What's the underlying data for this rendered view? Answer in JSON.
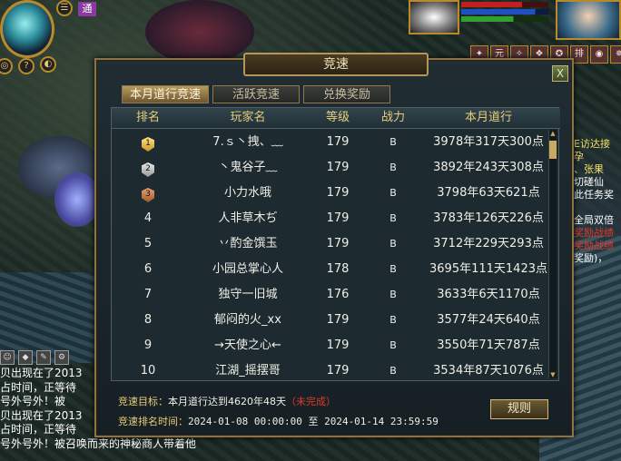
{
  "hud": {
    "tag": "通",
    "side_lines": [
      "E访达接",
      "孕",
      "、张果",
      "切磋仙",
      "此任务奖",
      "全局双倍",
      "奖励战绩",
      "奖励战绩",
      "奖励)，"
    ]
  },
  "chat": {
    "lines": [
      "贝出现在了2013",
      "占时间，正等待",
      "号外号外！被",
      "贝出现在了2013",
      "占时间，正等待",
      "号外号外！被召唤而来的神秘商人带着他"
    ]
  },
  "dialog": {
    "title": "竞速",
    "close": "X",
    "tabs": [
      {
        "label": "本月道行竞速",
        "active": true
      },
      {
        "label": "活跃竞速",
        "active": false
      },
      {
        "label": "兑换奖励",
        "active": false
      }
    ],
    "columns": [
      "排名",
      "玩家名",
      "等级",
      "战力",
      "本月道行"
    ],
    "rows": [
      {
        "rank": "1",
        "medal": "gold",
        "name": "7.ｓ丶拽、﹏",
        "level": "179",
        "power": "B",
        "dao": "3978年317天300点"
      },
      {
        "rank": "2",
        "medal": "silver",
        "name": "丶鬼谷子﹏",
        "level": "179",
        "power": "B",
        "dao": "3892年243天308点"
      },
      {
        "rank": "3",
        "medal": "bronze",
        "name": "小力水哦",
        "level": "179",
        "power": "B",
        "dao": "3798年63天621点"
      },
      {
        "rank": "4",
        "medal": "",
        "name": "人非草木ぢ",
        "level": "179",
        "power": "B",
        "dao": "3783年126天226点"
      },
      {
        "rank": "5",
        "medal": "",
        "name": "丷酌金馔玉",
        "level": "179",
        "power": "B",
        "dao": "3712年229天293点"
      },
      {
        "rank": "6",
        "medal": "",
        "name": "小园总掌心人",
        "level": "178",
        "power": "B",
        "dao": "3695年111天1423点"
      },
      {
        "rank": "7",
        "medal": "",
        "name": "独守一旧城",
        "level": "176",
        "power": "B",
        "dao": "3633年6天1170点"
      },
      {
        "rank": "8",
        "medal": "",
        "name": "郁闷的火_xx",
        "level": "179",
        "power": "B",
        "dao": "3577年24天640点"
      },
      {
        "rank": "9",
        "medal": "",
        "name": "→天使之心←",
        "level": "179",
        "power": "B",
        "dao": "3550年71天787点"
      },
      {
        "rank": "10",
        "medal": "",
        "name": "江湖_摇摆哥",
        "level": "179",
        "power": "B",
        "dao": "3534年87天1076点"
      }
    ],
    "goal_label": "竞速目标：",
    "goal_text": "本月道行达到4620年48天",
    "goal_status": "（未完成）",
    "time_label": "竞速排名时间：",
    "time_text": "2024-01-08 00:00:00 至 2024-01-14 23:59:59",
    "rules_button": "规则"
  },
  "colors": {
    "accent_gold": "#e7cd7a",
    "status_red": "#e03a2a",
    "frame": "#8a7444"
  }
}
